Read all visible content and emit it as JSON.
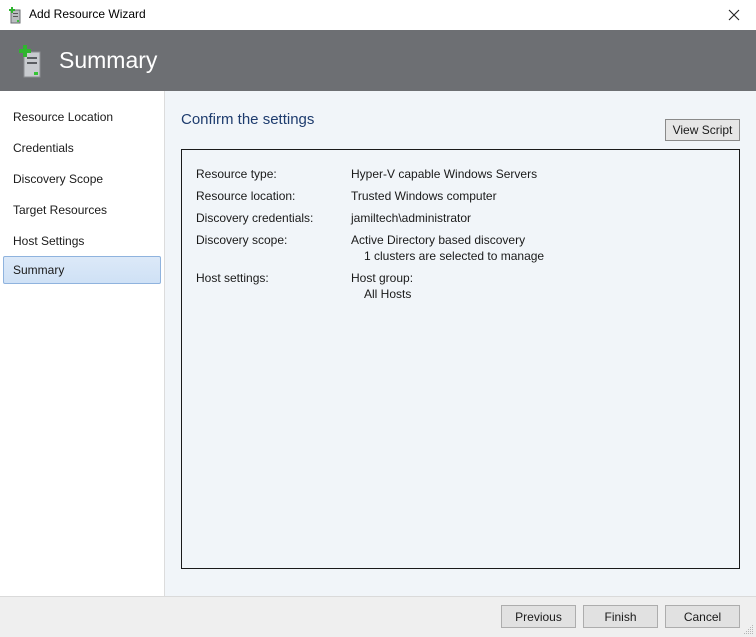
{
  "window": {
    "title": "Add Resource Wizard",
    "app_icon": "server-add-icon",
    "close_icon": "close-icon"
  },
  "header": {
    "title": "Summary",
    "icon": "server-add-icon"
  },
  "sidebar": {
    "items": [
      {
        "label": "Resource Location",
        "active": false
      },
      {
        "label": "Credentials",
        "active": false
      },
      {
        "label": "Discovery Scope",
        "active": false
      },
      {
        "label": "Target Resources",
        "active": false
      },
      {
        "label": "Host Settings",
        "active": false
      },
      {
        "label": "Summary",
        "active": true
      }
    ]
  },
  "main": {
    "heading": "Confirm the settings",
    "view_script_label": "View Script",
    "summary": [
      {
        "label": "Resource type:",
        "value": "Hyper-V capable Windows Servers",
        "sub": ""
      },
      {
        "label": "Resource location:",
        "value": "Trusted Windows computer",
        "sub": ""
      },
      {
        "label": "Discovery credentials:",
        "value": "jamiltech\\administrator",
        "sub": ""
      },
      {
        "label": "Discovery scope:",
        "value": "Active Directory based discovery",
        "sub": "1 clusters are selected to manage"
      },
      {
        "label": "Host settings:",
        "value": "Host group:",
        "sub": "All Hosts"
      }
    ]
  },
  "footer": {
    "previous_label": "Previous",
    "finish_label": "Finish",
    "cancel_label": "Cancel"
  },
  "colors": {
    "header_bg": "#6d6f73",
    "heading_text": "#1e3c6e",
    "active_nav_bg": "#cfe1f6",
    "active_nav_border": "#8fb3de",
    "main_bg": "#f1f5f9"
  }
}
